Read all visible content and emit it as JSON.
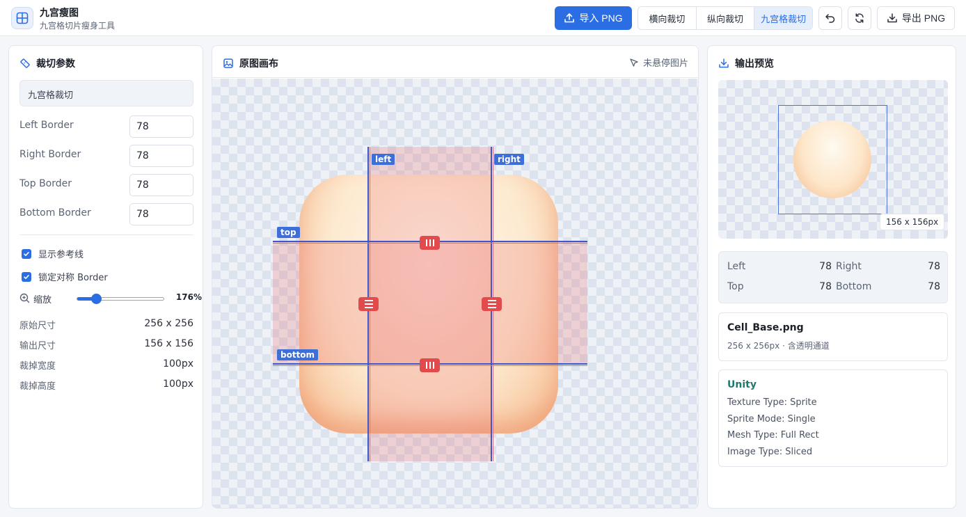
{
  "header": {
    "title": "九宫瘦图",
    "subtitle": "九宫格切片瘦身工具",
    "import_label": "导入 PNG",
    "modes": [
      {
        "label": "横向裁切",
        "active": false
      },
      {
        "label": "纵向裁切",
        "active": false
      },
      {
        "label": "九宫格裁切",
        "active": true
      }
    ],
    "export_label": "导出 PNG"
  },
  "left": {
    "title": "裁切参数",
    "mode_value": "九宫格裁切",
    "fields": [
      {
        "label": "Left Border",
        "value": "78"
      },
      {
        "label": "Right Border",
        "value": "78"
      },
      {
        "label": "Top Border",
        "value": "78"
      },
      {
        "label": "Bottom Border",
        "value": "78"
      }
    ],
    "checks": [
      {
        "label": "显示参考线",
        "checked": true
      },
      {
        "label": "锁定对称 Border",
        "checked": true
      }
    ],
    "zoom_label": "缩放",
    "zoom_value": "176%",
    "zoom_fraction": 0.22,
    "info": [
      {
        "k": "原始尺寸",
        "v": "256 x 256"
      },
      {
        "k": "输出尺寸",
        "v": "156 x 156"
      },
      {
        "k": "裁掉宽度",
        "v": "100px"
      },
      {
        "k": "裁掉高度",
        "v": "100px"
      }
    ]
  },
  "mid": {
    "title": "原图画布",
    "hover_status": "未悬停图片",
    "guide_labels": {
      "left": "left",
      "right": "right",
      "top": "top",
      "bottom": "bottom"
    }
  },
  "right": {
    "title": "输出预览",
    "size_badge": "156 x 156px",
    "borders": {
      "left_k": "Left",
      "left_v": "78",
      "right_k": "Right",
      "right_v": "78",
      "top_k": "Top",
      "top_v": "78",
      "bottom_k": "Bottom",
      "bottom_v": "78"
    },
    "file": {
      "name": "Cell_Base.png",
      "meta": "256 x 256px · 含透明通道"
    },
    "unity": {
      "title": "Unity",
      "lines": [
        "Texture Type: Sprite",
        "Sprite Mode: Single",
        "Mesh Type: Full Rect",
        "Image Type: Sliced"
      ]
    }
  },
  "colors": {
    "accent": "#2b6de3",
    "guide": "#3e56c9",
    "handle": "#e24b4b",
    "unity": "#1f7a6d"
  }
}
